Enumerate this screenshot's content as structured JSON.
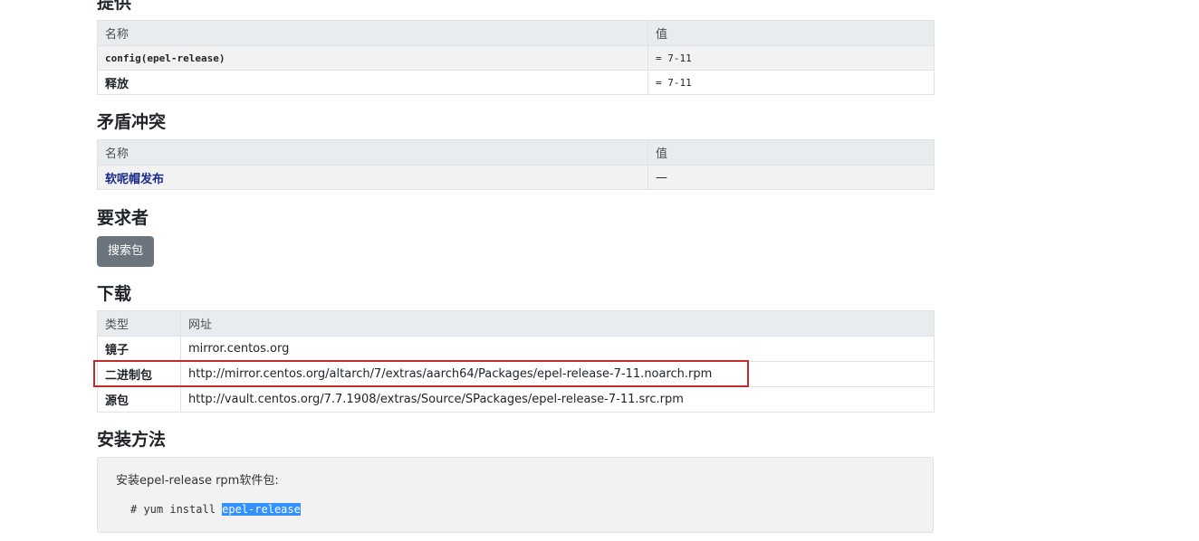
{
  "provides": {
    "heading": "提供",
    "col_name": "名称",
    "col_value": "值",
    "rows": [
      {
        "name": "config(epel-release)",
        "value": "= 7-11"
      },
      {
        "name": "释放",
        "value": "= 7-11"
      }
    ]
  },
  "conflicts": {
    "heading": "矛盾冲突",
    "col_name": "名称",
    "col_value": "值",
    "rows": [
      {
        "name": "软呢帽发布",
        "value": "—"
      }
    ]
  },
  "required_by": {
    "heading": "要求者",
    "search_button": "搜索包"
  },
  "download": {
    "heading": "下载",
    "col_type": "类型",
    "col_url": "网址",
    "rows": [
      {
        "type": "镜子",
        "url": "mirror.centos.org"
      },
      {
        "type": "二进制包",
        "url": "http://mirror.centos.org/altarch/7/extras/aarch64/Packages/epel-release-7-11.noarch.rpm"
      },
      {
        "type": "源包",
        "url": "http://vault.centos.org/7.7.1908/extras/Source/SPackages/epel-release-7-11.src.rpm"
      }
    ]
  },
  "install": {
    "heading": "安装方法",
    "description": "安装epel-release rpm软件包:",
    "command_prefix": "# yum install ",
    "command_package": "epel-release"
  },
  "colors": {
    "header_bg": "#e9ecef",
    "button_bg": "#6c757d",
    "highlight_border": "#c22c2c",
    "selection": "#3390ff",
    "link": "#1a2c8a"
  }
}
